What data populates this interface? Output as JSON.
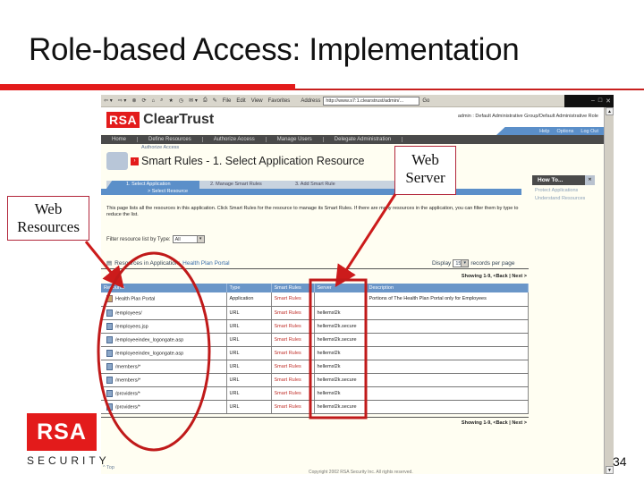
{
  "slide": {
    "title": "Role-based Access: Implementation",
    "page_number": "34",
    "accent_color": "#e31b1b"
  },
  "callouts": {
    "web_resources": "Web Resources",
    "web_server": "Web Server"
  },
  "footer_logo": {
    "brand": "RSA",
    "tagline": "SECURITY"
  },
  "browser": {
    "toolbar_icons": [
      "back-icon",
      "forward-icon",
      "stop-icon",
      "refresh-icon",
      "home-icon",
      "search-icon",
      "favorites-icon",
      "history-icon",
      "mail-icon",
      "print-icon",
      "edit-icon"
    ],
    "menu": [
      "File",
      "Edit",
      "View",
      "Favorites"
    ],
    "address_label": "Address",
    "address_value": "http://www.s7:1.clearstrust/admin/...",
    "go_label": "Go"
  },
  "app": {
    "brand_rsa": "RSA",
    "brand_name": "ClearTrust",
    "user_line": "admin : Default Administrative Group/Default Administrative Role",
    "top_links": [
      "Help",
      "Options",
      "Log Out"
    ],
    "nav": [
      "Home",
      "Define Resources",
      "Authorize Access",
      "Manage Users",
      "Delegate Administration"
    ],
    "breadcrumb": "Authorize Access",
    "page_title": "Smart Rules - 1. Select Application Resource",
    "wizard_steps": [
      "1. Select Application",
      "2. Manage Smart Rules",
      "3. Add Smart Rule"
    ],
    "wizard_substep": "> Select Resource",
    "intro": "This page lists all the resources in this application. Click Smart Rules for the resource to manage its Smart Rules. If there are many resources in the application, you can filter them by type to reduce the list.",
    "filter_label": "Filter resource list by Type:",
    "filter_value": "All",
    "resources_label": "Resources in Application:",
    "application_name": "Health Plan Portal",
    "display_label": "Display",
    "display_value": "15",
    "display_suffix": "records per page",
    "showing_top": "Showing 1-9, <Back | Next >",
    "showing_bottom": "Showing 1-9, <Back | Next >",
    "table": {
      "columns": [
        "Resource",
        "Type",
        "Smart Rules",
        "Server",
        "Description"
      ],
      "rows": [
        {
          "resource": "Health Plan Portal",
          "type": "Application",
          "rules": "Smart Rules",
          "server": "",
          "description": "Portions of The Health Plan Portal only for Employees",
          "icon": "app"
        },
        {
          "resource": "/employees/",
          "type": "URL",
          "rules": "Smart Rules",
          "server": "hellemxl2k",
          "description": "",
          "icon": "url"
        },
        {
          "resource": "/employees.jsp",
          "type": "URL",
          "rules": "Smart Rules",
          "server": "hellemxl2k.secure",
          "description": "",
          "icon": "url"
        },
        {
          "resource": "/employeeindex_logongate.asp",
          "type": "URL",
          "rules": "Smart Rules",
          "server": "hellemxl2k.secure",
          "description": "",
          "icon": "url"
        },
        {
          "resource": "/employeeindex_logongate.asp",
          "type": "URL",
          "rules": "Smart Rules",
          "server": "hellemxl2k",
          "description": "",
          "icon": "url"
        },
        {
          "resource": "/members/*",
          "type": "URL",
          "rules": "Smart Rules",
          "server": "hellemxl2k",
          "description": "",
          "icon": "url"
        },
        {
          "resource": "/members/*",
          "type": "URL",
          "rules": "Smart Rules",
          "server": "hellemxl2k.secure",
          "description": "",
          "icon": "url"
        },
        {
          "resource": "/providers/*",
          "type": "URL",
          "rules": "Smart Rules",
          "server": "hellemxl2k",
          "description": "",
          "icon": "url"
        },
        {
          "resource": "/providers/*",
          "type": "URL",
          "rules": "Smart Rules",
          "server": "hellemxl2k.secure",
          "description": "",
          "icon": "url"
        }
      ]
    },
    "how_to": {
      "title": "How To...",
      "links": [
        "Protect Applications",
        "Understand Resources"
      ]
    },
    "top_link": "^ Top",
    "copyright": "Copyright 2002 RSA Security Inc. All rights reserved."
  }
}
